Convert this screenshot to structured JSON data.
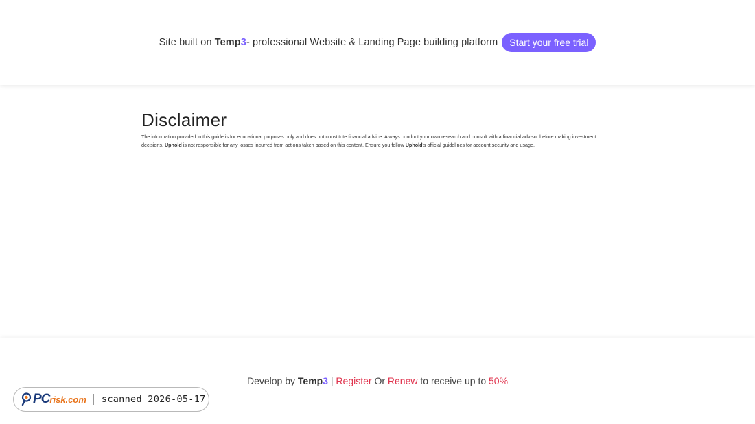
{
  "topbar": {
    "promo_prefix": "Site built on ",
    "brand_name": "Temp",
    "brand_digit": "3",
    "promo_suffix": "- professional Website & Landing Page building platform",
    "cta_label": "Start your free trial"
  },
  "disclaimer": {
    "title": "Disclaimer",
    "text_1": "The information provided in this guide is for educational purposes only and does not constitute financial advice. Always conduct your own research and consult with a financial advisor before making investment decisions. ",
    "brand_1": "Uphold",
    "text_2": " is not responsible for any losses incurred from actions taken based on this content. Ensure you follow ",
    "brand_2": "Uphold",
    "text_3": "'s official guidelines for account security and usage."
  },
  "footer": {
    "develop_prefix": "Develop by ",
    "brand_name": "Temp",
    "brand_digit": "3",
    "separator": " | ",
    "register_label": "Register",
    "or_label": " Or ",
    "renew_label": "Renew",
    "receive_text": " to receive up to ",
    "discount": "50%"
  },
  "badge": {
    "logo_pc": "PC",
    "logo_risk": "risk.com",
    "scan_text": "scanned 2026-05-17"
  },
  "colors": {
    "accent": "#7b61ff",
    "link_red": "#e0344e",
    "badge_blue": "#1a3a7a",
    "badge_orange": "#e8741c"
  }
}
